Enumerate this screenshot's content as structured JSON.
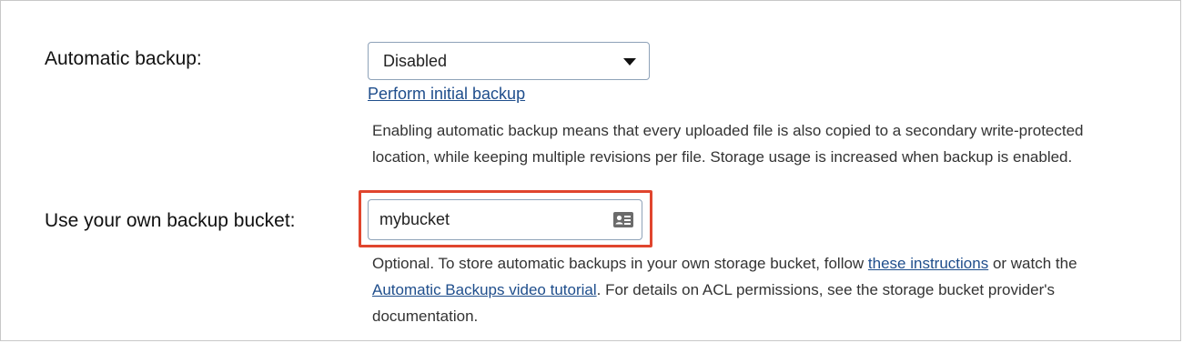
{
  "automatic_backup": {
    "label": "Automatic backup:",
    "selected": "Disabled",
    "initial_backup_link": "Perform initial backup",
    "help_line_1": "Enabling automatic backup means that every uploaded file is also copied to a secondary write-protected",
    "help_line_2": "location, while keeping multiple revisions per file. Storage usage is increased when backup is enabled."
  },
  "backup_bucket": {
    "label": "Use your own backup bucket:",
    "value": "mybucket",
    "icon": "contact-card-icon",
    "help_part_1": "Optional. To store automatic backups in your own storage bucket, follow ",
    "instructions_link": "these instructions",
    "help_part_2": " or watch the",
    "video_link": "Automatic Backups video tutorial",
    "help_part_3": ". For details on ACL permissions, see the storage bucket provider's",
    "help_part_4": "documentation."
  },
  "colors": {
    "link": "#1f4e8c",
    "highlight": "#e0452e",
    "field_border": "#8ea2b8"
  }
}
